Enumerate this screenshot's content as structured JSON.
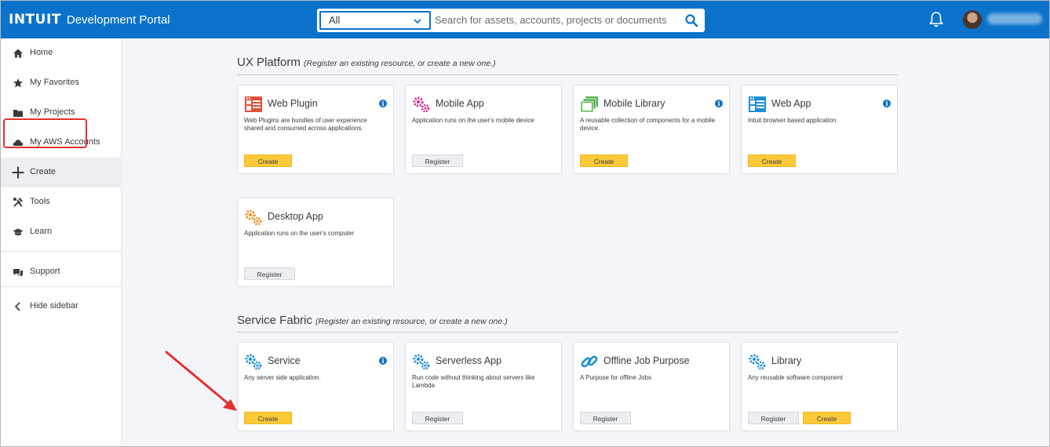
{
  "header": {
    "brand": "INTUIT",
    "portal": "Development Portal",
    "scope_selected": "All",
    "search_placeholder": "Search for assets, accounts, projects or documents",
    "colors": {
      "bar": "#0b72cc",
      "accent_create": "#fcc938"
    }
  },
  "sidebar": {
    "items": [
      {
        "label": "Home",
        "icon": "home-icon"
      },
      {
        "label": "My Favorites",
        "icon": "star-icon"
      },
      {
        "label": "My Projects",
        "icon": "folder-icon"
      },
      {
        "label": "My AWS Accounts",
        "icon": "cloud-icon"
      },
      {
        "label": "Create",
        "icon": "plus-icon"
      },
      {
        "label": "Tools",
        "icon": "tools-icon"
      },
      {
        "label": "Learn",
        "icon": "graduation-cap-icon"
      },
      {
        "label": "Support",
        "icon": "support-icon"
      },
      {
        "label": "Hide sidebar",
        "icon": "chevron-left-icon"
      }
    ]
  },
  "sections": [
    {
      "title": "UX Platform",
      "note": "(Register an existing resource, or create a new one.)",
      "cards": [
        {
          "title": "Web Plugin",
          "desc": "Web Plugins are bundles of user experience shared and consumed across applications.",
          "buttons": [
            "Create"
          ],
          "icon": "web-plugin-icon"
        },
        {
          "title": "Mobile App",
          "desc": "Application runs on the user's mobile device",
          "buttons": [
            "Register"
          ],
          "icon": "gears-pink-icon"
        },
        {
          "title": "Mobile Library",
          "desc": "A reusable collection of components for a mobile device.",
          "buttons": [
            "Create"
          ],
          "icon": "library-stack-icon"
        },
        {
          "title": "Web App",
          "desc": "Intuit browser based application",
          "buttons": [
            "Create"
          ],
          "icon": "web-app-icon"
        },
        {
          "title": "Desktop App",
          "desc": "Application runs on the user's computer",
          "buttons": [
            "Register"
          ],
          "icon": "gears-orange-icon"
        }
      ]
    },
    {
      "title": "Service Fabric",
      "note": "(Register an existing resource, or create a new one.)",
      "cards": [
        {
          "title": "Service",
          "desc": "Any server side application.",
          "buttons": [
            "Create"
          ],
          "icon": "gears-blue-icon"
        },
        {
          "title": "Serverless App",
          "desc": "Run code without thinking about servers like Lambda",
          "buttons": [
            "Register"
          ],
          "icon": "gears-blue-icon"
        },
        {
          "title": "Offline Job Purpose",
          "desc": "A Purpose for offline Jobs",
          "buttons": [
            "Register"
          ],
          "icon": "link-icon"
        },
        {
          "title": "Library",
          "desc": "Any reusable software component",
          "buttons": [
            "Register",
            "Create"
          ],
          "icon": "gears-blue-icon"
        }
      ]
    }
  ]
}
